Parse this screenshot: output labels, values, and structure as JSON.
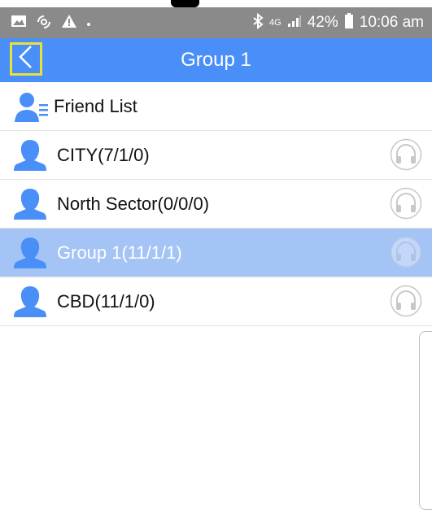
{
  "status_bar": {
    "left_icons": [
      "gallery-icon",
      "signal-hotspot-icon",
      "warning-icon",
      "dot-icon"
    ],
    "bluetooth_icon": "bluetooth-icon",
    "network": "4G",
    "battery": "42%",
    "time": "10:06 am"
  },
  "navbar": {
    "back_icon": "chevron-left-icon",
    "title": "Group 1"
  },
  "list": {
    "items": [
      {
        "label": "Friend List",
        "icon": "friend-list-icon",
        "headset": false,
        "selected": false
      },
      {
        "label": "CITY(7/1/0)",
        "icon": "person-icon",
        "headset": true,
        "selected": false
      },
      {
        "label": "North Sector(0/0/0)",
        "icon": "person-icon",
        "headset": true,
        "selected": false
      },
      {
        "label": "Group 1(11/1/1)",
        "icon": "person-icon",
        "headset": true,
        "selected": true
      },
      {
        "label": "CBD(11/1/0)",
        "icon": "person-icon",
        "headset": true,
        "selected": false
      }
    ]
  },
  "colors": {
    "accent": "#4a8ff7",
    "selected_row": "#a4c4f6",
    "status_bar": "#8a8a8a",
    "back_highlight": "#e8e13a"
  }
}
